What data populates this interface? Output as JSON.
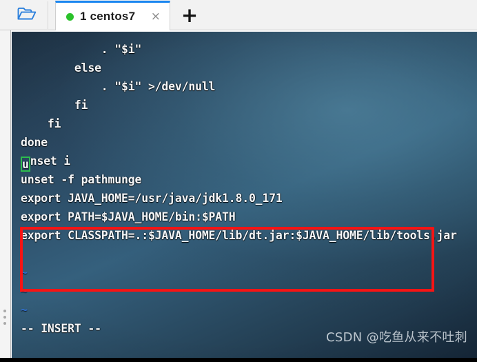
{
  "window": {
    "toolbar": {
      "folder_icon": "open-folder-icon",
      "new_tab_label": "+"
    },
    "tabs": [
      {
        "label": "1 centos7",
        "status_dot_color": "#2bc22b",
        "close_label": "×",
        "active": true
      }
    ]
  },
  "terminal": {
    "editor": "vim",
    "mode_line": "-- INSERT --",
    "cursor": {
      "row": 6,
      "col": 1,
      "char": "u",
      "color": "#2dbd4e"
    },
    "lines": [
      {
        "text": "            . \"$i\"",
        "type": "code"
      },
      {
        "text": "        else",
        "type": "code"
      },
      {
        "text": "            . \"$i\" >/dev/null",
        "type": "code"
      },
      {
        "text": "        fi",
        "type": "code"
      },
      {
        "text": "    fi",
        "type": "code"
      },
      {
        "text": "done",
        "type": "code"
      },
      {
        "text": "unset i",
        "type": "code-cursor",
        "cursor_prefix": "u",
        "cursor_rest": "nset i"
      },
      {
        "text": "unset -f pathmunge",
        "type": "code"
      },
      {
        "text": "export JAVA_HOME=/usr/java/jdk1.8.0_171",
        "type": "code-highlight"
      },
      {
        "text": "export PATH=$JAVA_HOME/bin:$PATH",
        "type": "code-highlight"
      },
      {
        "text": "export CLASSPATH=.:$JAVA_HOME/lib/dt.jar:$JAVA_HOME/lib/tools.jar",
        "type": "code-highlight"
      },
      {
        "text": "",
        "type": "blank"
      },
      {
        "text": "~",
        "type": "tilde"
      },
      {
        "text": "~",
        "type": "tilde"
      },
      {
        "text": "~",
        "type": "tilde"
      },
      {
        "text": "-- INSERT --",
        "type": "status"
      }
    ]
  },
  "annotation": {
    "highlight_box_color": "#f81414"
  },
  "watermark": {
    "text": "CSDN @吃鱼从来不吐刺"
  }
}
